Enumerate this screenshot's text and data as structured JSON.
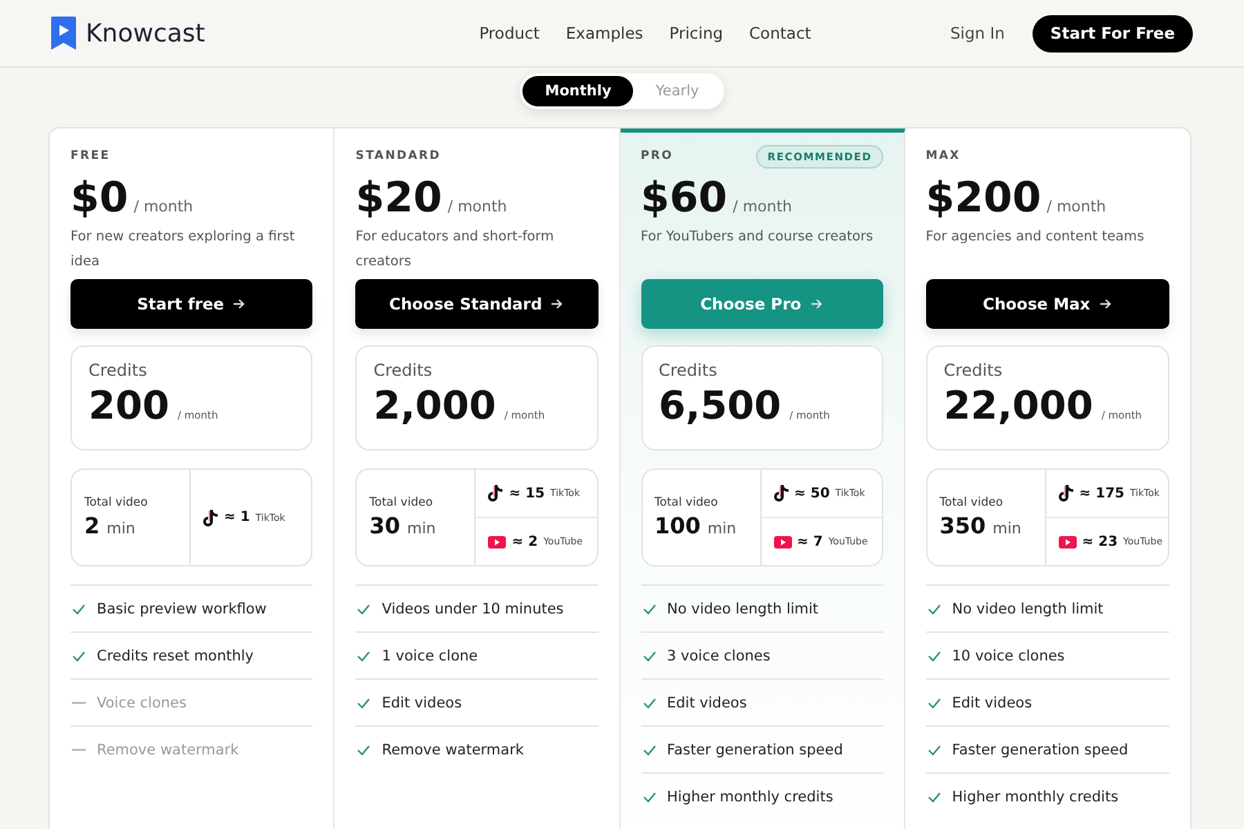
{
  "header": {
    "brand": "Knowcast",
    "nav": [
      {
        "label": "Product"
      },
      {
        "label": "Examples"
      },
      {
        "label": "Pricing"
      },
      {
        "label": "Contact"
      }
    ],
    "sign_in": "Sign In",
    "cta": "Start For Free"
  },
  "billing_toggle": [
    {
      "label": "Monthly",
      "selected": true
    },
    {
      "label": "Yearly",
      "selected": false
    }
  ],
  "plans": [
    {
      "tier": "FREE",
      "price": "$0",
      "period": "/ month",
      "description": "For new creators exploring a first idea",
      "highlighted": false,
      "button": "Start free",
      "credits_label": "Credits",
      "credits": "200",
      "credits_period": "/ month",
      "video_label": "Total video",
      "video_amount": "2",
      "video_unit": "min",
      "platforms": [
        {
          "kind": "tiktok",
          "count": "≈ 1",
          "label": "TikTok"
        }
      ],
      "features": [
        {
          "text": "Basic preview workflow",
          "included": true
        },
        {
          "text": "Credits reset monthly",
          "included": true
        },
        {
          "text": "Voice clones",
          "included": false
        },
        {
          "text": "Remove watermark",
          "included": false
        }
      ]
    },
    {
      "tier": "STANDARD",
      "price": "$20",
      "period": "/ month",
      "description": "For educators and short-form creators",
      "highlighted": false,
      "button": "Choose Standard",
      "credits_label": "Credits",
      "credits": "2,000",
      "credits_period": "/ month",
      "video_label": "Total video",
      "video_amount": "30",
      "video_unit": "min",
      "platforms": [
        {
          "kind": "tiktok",
          "count": "≈ 15",
          "label": "TikTok"
        },
        {
          "kind": "youtube",
          "count": "≈ 2",
          "label": "YouTube"
        }
      ],
      "features": [
        {
          "text": "Videos under 10 minutes",
          "included": true
        },
        {
          "text": "1 voice clone",
          "included": true
        },
        {
          "text": "Edit videos",
          "included": true
        },
        {
          "text": "Remove watermark",
          "included": true
        }
      ]
    },
    {
      "tier": "PRO",
      "badge": "RECOMMENDED",
      "price": "$60",
      "period": "/ month",
      "description": "For YouTubers and course creators",
      "highlighted": true,
      "button": "Choose Pro",
      "credits_label": "Credits",
      "credits": "6,500",
      "credits_period": "/ month",
      "video_label": "Total video",
      "video_amount": "100",
      "video_unit": "min",
      "platforms": [
        {
          "kind": "tiktok",
          "count": "≈ 50",
          "label": "TikTok"
        },
        {
          "kind": "youtube",
          "count": "≈ 7",
          "label": "YouTube"
        }
      ],
      "features": [
        {
          "text": "No video length limit",
          "included": true
        },
        {
          "text": "3 voice clones",
          "included": true
        },
        {
          "text": "Edit videos",
          "included": true
        },
        {
          "text": "Faster generation speed",
          "included": true
        },
        {
          "text": "Higher monthly credits",
          "included": true
        }
      ]
    },
    {
      "tier": "MAX",
      "price": "$200",
      "period": "/ month",
      "description": "For agencies and content teams",
      "highlighted": false,
      "button": "Choose Max",
      "credits_label": "Credits",
      "credits": "22,000",
      "credits_period": "/ month",
      "video_label": "Total video",
      "video_amount": "350",
      "video_unit": "min",
      "platforms": [
        {
          "kind": "tiktok",
          "count": "≈ 175",
          "label": "TikTok"
        },
        {
          "kind": "youtube",
          "count": "≈ 23",
          "label": "YouTube"
        }
      ],
      "features": [
        {
          "text": "No video length limit",
          "included": true
        },
        {
          "text": "10 voice clones",
          "included": true
        },
        {
          "text": "Edit videos",
          "included": true
        },
        {
          "text": "Faster generation speed",
          "included": true
        },
        {
          "text": "Higher monthly credits",
          "included": true
        }
      ]
    }
  ]
}
